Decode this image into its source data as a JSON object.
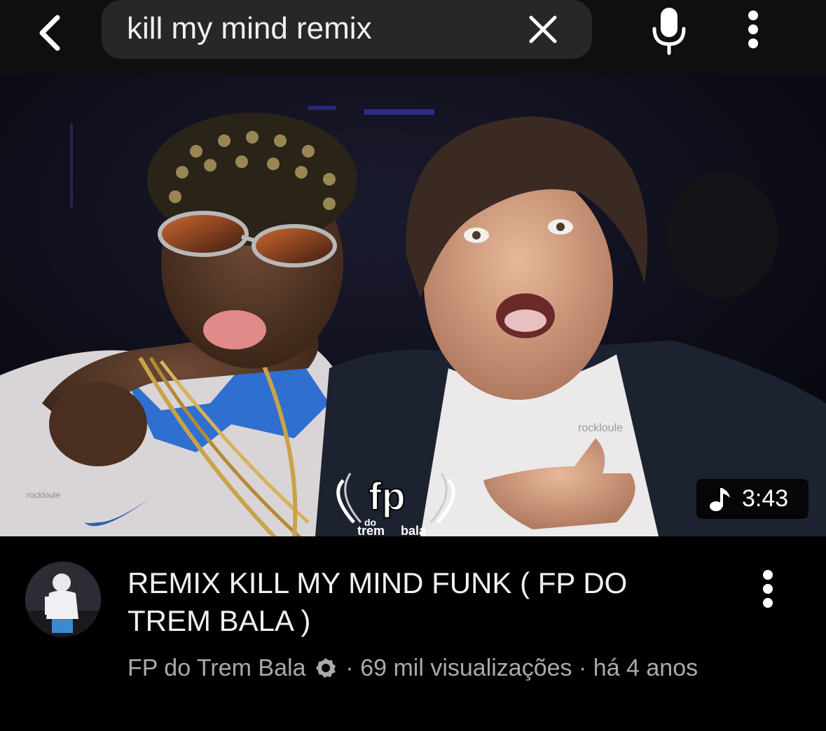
{
  "header": {
    "back_icon": "chevron-left-icon",
    "search": {
      "query": "kill my mind remix",
      "clear_icon": "close-icon"
    },
    "mic_icon": "microphone-icon",
    "more_icon": "more-vertical-icon"
  },
  "video": {
    "thumbnail": {
      "watermarks": [
        "rockloule",
        "rockloule"
      ],
      "logo_text": [
        "fp",
        "do",
        "trem",
        "bala"
      ],
      "duration_icon": "music-note-icon",
      "duration": "3:43"
    },
    "title": "REMIX KILL MY MIND FUNK ( FP DO TREM BALA )",
    "channel": "FP do Trem Bala",
    "verified_icon": "verified-badge-icon",
    "separator": "·",
    "views": "69 mil visualizações",
    "age": "há 4 anos",
    "more_icon": "more-vertical-icon"
  },
  "colors": {
    "background": "#000000",
    "search_bg": "#272727",
    "primary_text": "#f1f1f1",
    "secondary_text": "#aaaaaa"
  }
}
